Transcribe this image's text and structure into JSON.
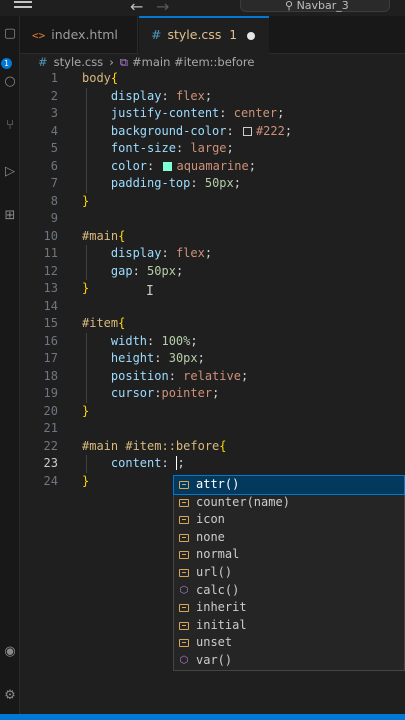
{
  "titlebar": {
    "search_text": "Navbar_3"
  },
  "activity": {
    "badge": "1"
  },
  "tabs": [
    {
      "name": "index.html",
      "icon": "<>"
    },
    {
      "name": "style.css",
      "icon": "#",
      "modified_count": "1"
    }
  ],
  "breadcrumb": {
    "file": "style.css",
    "symbol": "#main #item::before"
  },
  "lines": [
    {
      "n": "1"
    },
    {
      "n": "2"
    },
    {
      "n": "3"
    },
    {
      "n": "4"
    },
    {
      "n": "5"
    },
    {
      "n": "6"
    },
    {
      "n": "7"
    },
    {
      "n": "8"
    },
    {
      "n": "9"
    },
    {
      "n": "10"
    },
    {
      "n": "11"
    },
    {
      "n": "12"
    },
    {
      "n": "13"
    },
    {
      "n": "14"
    },
    {
      "n": "15"
    },
    {
      "n": "16"
    },
    {
      "n": "17"
    },
    {
      "n": "18"
    },
    {
      "n": "19"
    },
    {
      "n": "20"
    },
    {
      "n": "21"
    },
    {
      "n": "22"
    },
    {
      "n": "23"
    },
    {
      "n": "24"
    }
  ],
  "code": {
    "l1_sel": "body",
    "l2_prop": "display",
    "l2_val": "flex",
    "l3_prop": "justify-content",
    "l3_val": "center",
    "l4_prop": "background-color",
    "l4_val": "#222",
    "l5_prop": "font-size",
    "l5_val": "large",
    "l6_prop": "color",
    "l6_val": "aquamarine",
    "l7_prop": "padding-top",
    "l7_val": "50px",
    "l10_sel": "#main",
    "l11_prop": "display",
    "l11_val": "flex",
    "l12_prop": "gap",
    "l12_val": "50px",
    "l15_sel": "#item",
    "l16_prop": "width",
    "l16_val": "100%",
    "l17_prop": "height",
    "l17_val": "30px",
    "l18_prop": "position",
    "l18_val": "relative",
    "l19_prop": "cursor",
    "l19_val": "pointer",
    "l22_sel": "#main #item::before",
    "l23_prop": "content"
  },
  "colors": {
    "swatch_222": "#222222",
    "swatch_aquamarine": "#7fffd4",
    "accent": "#0078d4"
  },
  "suggestions": [
    {
      "label": "attr()",
      "icon": "keyword-icon"
    },
    {
      "label": "counter(name)",
      "icon": "keyword-icon"
    },
    {
      "label": "icon",
      "icon": "keyword-icon"
    },
    {
      "label": "none",
      "icon": "keyword-icon"
    },
    {
      "label": "normal",
      "icon": "keyword-icon"
    },
    {
      "label": "url()",
      "icon": "keyword-icon"
    },
    {
      "label": "calc()",
      "icon": "function-icon"
    },
    {
      "label": "inherit",
      "icon": "keyword-icon"
    },
    {
      "label": "initial",
      "icon": "keyword-icon"
    },
    {
      "label": "unset",
      "icon": "keyword-icon"
    },
    {
      "label": "var()",
      "icon": "function-icon"
    }
  ]
}
